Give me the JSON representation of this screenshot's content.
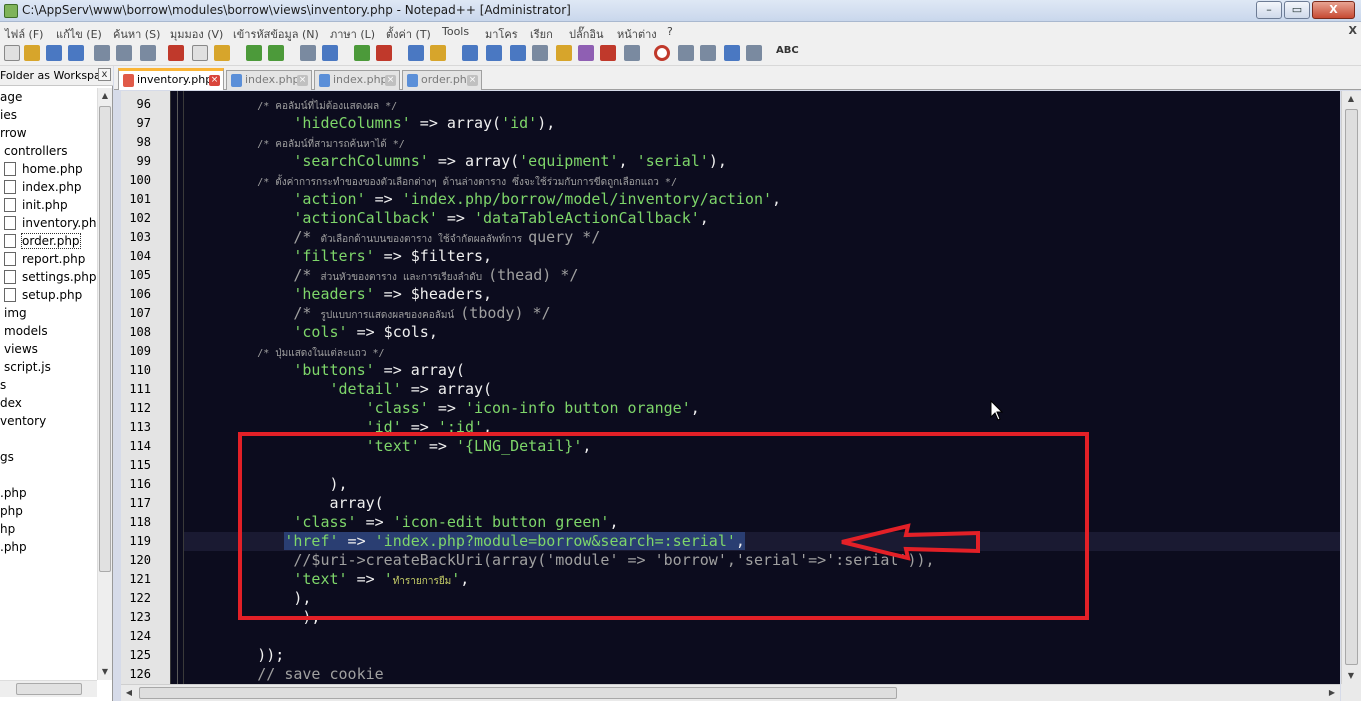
{
  "window": {
    "title": "C:\\AppServ\\www\\borrow\\modules\\borrow\\views\\inventory.php - Notepad++ [Administrator]",
    "minimize": "–",
    "maximize": "▭",
    "close": "X"
  },
  "menu": {
    "items": [
      "ไฟล์ (F)",
      "แก้ไข (E)",
      "ค้นหา (S)",
      "มุมมอง (V)",
      "เข้ารหัสข้อมูล (N)",
      "ภาษา (L)",
      "ตั้งค่า (T)",
      "Tools",
      "มาโคร",
      "เรียก",
      "ปลั๊กอิน",
      "หน้าต่าง",
      "?"
    ],
    "close_glyph": "X"
  },
  "toolbar": {
    "spell_label": "ABC"
  },
  "sidebar": {
    "header_label": "Folder as Workspa...",
    "close_glyph": "x",
    "tree": [
      {
        "label": "age",
        "indent": 0,
        "file": false
      },
      {
        "label": "ies",
        "indent": 0,
        "file": false
      },
      {
        "label": "rrow",
        "indent": 0,
        "file": false
      },
      {
        "label": "controllers",
        "indent": 1,
        "file": false
      },
      {
        "label": "home.php",
        "indent": 2,
        "file": true
      },
      {
        "label": "index.php",
        "indent": 2,
        "file": true
      },
      {
        "label": "init.php",
        "indent": 2,
        "file": true
      },
      {
        "label": "inventory.php",
        "indent": 2,
        "file": true
      },
      {
        "label": "order.php",
        "indent": 2,
        "file": true,
        "selected": true
      },
      {
        "label": "report.php",
        "indent": 2,
        "file": true
      },
      {
        "label": "settings.php",
        "indent": 2,
        "file": true
      },
      {
        "label": "setup.php",
        "indent": 2,
        "file": true
      },
      {
        "label": "img",
        "indent": 1,
        "file": false
      },
      {
        "label": "models",
        "indent": 1,
        "file": false
      },
      {
        "label": "views",
        "indent": 1,
        "file": false
      },
      {
        "label": "script.js",
        "indent": 1,
        "file": false
      },
      {
        "label": "s",
        "indent": 0,
        "file": false
      },
      {
        "label": "dex",
        "indent": 0,
        "file": false
      },
      {
        "label": "ventory",
        "indent": 0,
        "file": false
      },
      {
        "label": "",
        "indent": 0,
        "file": false
      },
      {
        "label": "gs",
        "indent": 0,
        "file": false
      },
      {
        "label": "",
        "indent": 0,
        "file": false
      },
      {
        "label": ".php",
        "indent": 0,
        "file": false
      },
      {
        "label": "php",
        "indent": 0,
        "file": false
      },
      {
        "label": "hp",
        "indent": 0,
        "file": false
      },
      {
        "label": ".php",
        "indent": 0,
        "file": false
      }
    ]
  },
  "tabs": [
    {
      "label": "inventory.php",
      "active": true
    },
    {
      "label": "index.php",
      "active": false
    },
    {
      "label": "index.php",
      "active": false
    },
    {
      "label": "order.php",
      "active": false
    }
  ],
  "editor": {
    "current_line": 119,
    "lines": [
      {
        "n": "96",
        "t": "            /* คอลัมน์ที่ไม่ต้องแสดงผล */",
        "kind": "thai"
      },
      {
        "n": "97",
        "t": "            'hideColumns' => array('id'),",
        "kind": "code"
      },
      {
        "n": "98",
        "t": "            /* คอลัมน์ที่สามารถค้นหาได้ */",
        "kind": "thai"
      },
      {
        "n": "99",
        "t": "            'searchColumns' => array('equipment', 'serial'),",
        "kind": "code"
      },
      {
        "n": "100",
        "t": "            /* ตั้งค่าการกระทำของของตัวเลือกต่างๆ ด้านล่างตาราง ซึ่งจะใช้ร่วมกับการขีดถูกเลือกแถว */",
        "kind": "thai"
      },
      {
        "n": "101",
        "t": "            'action' => 'index.php/borrow/model/inventory/action',",
        "kind": "code"
      },
      {
        "n": "102",
        "t": "            'actionCallback' => 'dataTableActionCallback',",
        "kind": "code"
      },
      {
        "n": "103",
        "t": "            /* ตัวเลือกด้านบนของตาราง ใช้จำกัดผลลัพท์การ query */",
        "kind": "mixed"
      },
      {
        "n": "104",
        "t": "            'filters' => $filters,",
        "kind": "code"
      },
      {
        "n": "105",
        "t": "            /* ส่วนหัวของตาราง และการเรียงลำดับ (thead) */",
        "kind": "mixed"
      },
      {
        "n": "106",
        "t": "            'headers' => $headers,",
        "kind": "code"
      },
      {
        "n": "107",
        "t": "            /* รูปแบบการแสดงผลของคอลัมน์ (tbody) */",
        "kind": "mixed"
      },
      {
        "n": "108",
        "t": "            'cols' => $cols,",
        "kind": "code"
      },
      {
        "n": "109",
        "t": "            /* ปุ่มแสดงในแต่ละแถว */",
        "kind": "thai"
      },
      {
        "n": "110",
        "t": "            'buttons' => array(",
        "kind": "code"
      },
      {
        "n": "111",
        "t": "                'detail' => array(",
        "kind": "code"
      },
      {
        "n": "112",
        "t": "                    'class' => 'icon-info button orange',",
        "kind": "code"
      },
      {
        "n": "113",
        "t": "                    'id' => ':id',",
        "kind": "code"
      },
      {
        "n": "114",
        "t": "                    'text' => '{LNG_Detail}',",
        "kind": "code"
      },
      {
        "n": "115",
        "t": "",
        "kind": "code"
      },
      {
        "n": "116",
        "t": "                ),",
        "kind": "code"
      },
      {
        "n": "117",
        "t": "                array(",
        "kind": "code"
      },
      {
        "n": "118",
        "t": "            'class' => 'icon-edit button green',",
        "kind": "code"
      },
      {
        "n": "119",
        "t": "           'href' => 'index.php?module=borrow&search=:serial',",
        "kind": "selected"
      },
      {
        "n": "120",
        "t": "            //$uri->createBackUri(array('module' => 'borrow','serial'=>':serial')),",
        "kind": "comment"
      },
      {
        "n": "121",
        "t": "            'text' => 'ทำรายการยืม',",
        "kind": "code"
      },
      {
        "n": "122",
        "t": "            ),",
        "kind": "code"
      },
      {
        "n": "123",
        "t": "             ),",
        "kind": "code"
      },
      {
        "n": "124",
        "t": "",
        "kind": "code"
      },
      {
        "n": "125",
        "t": "        ));",
        "kind": "code"
      },
      {
        "n": "126",
        "t": "        // save cookie",
        "kind": "comment"
      }
    ]
  },
  "colors": {
    "editor_bg": "#0c0c1e",
    "string": "#7ed66a",
    "annotation": "#e32027",
    "selection": "#2a3e72"
  }
}
